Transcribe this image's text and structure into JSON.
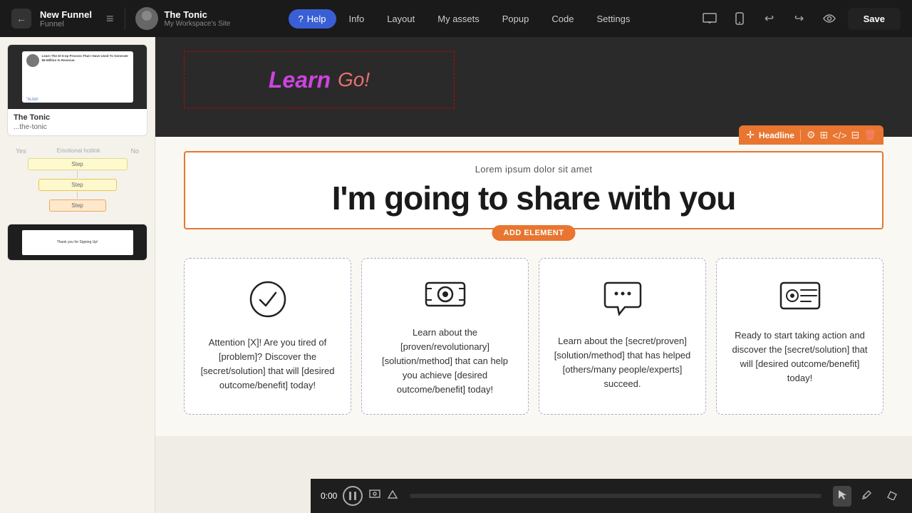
{
  "header": {
    "back_label": "←",
    "project_title": "New Funnel",
    "project_subtitle": "Funnel",
    "site_name": "The Tonic",
    "site_subtitle": "My Workspace's Site",
    "tabs": [
      {
        "id": "help",
        "label": "Help",
        "active": true
      },
      {
        "id": "info",
        "label": "Info",
        "active": false
      },
      {
        "id": "layout",
        "label": "Layout",
        "active": false
      },
      {
        "id": "my_assets",
        "label": "My assets",
        "active": false
      },
      {
        "id": "popup",
        "label": "Popup",
        "active": false
      },
      {
        "id": "code",
        "label": "Code",
        "active": false
      },
      {
        "id": "settings",
        "label": "Settings",
        "active": false
      }
    ],
    "device_icons": [
      "desktop",
      "mobile"
    ],
    "action_icons": [
      "undo",
      "redo",
      "preview"
    ],
    "save_label": "Save"
  },
  "headline_element": {
    "toolbar_label": "Headline",
    "label_above": "Lorem ipsum dolor sit amet",
    "main_text": "I'm going to share with you",
    "add_element_label": "ADD ELEMENT"
  },
  "feature_cards": [
    {
      "icon": "✓",
      "icon_type": "circle-check",
      "text": "Attention [X]! Are you tired of [problem]? Discover the [secret/solution] that will [desired outcome/benefit] today!"
    },
    {
      "icon": "💵",
      "icon_type": "money",
      "text": "Learn about the [proven/revolutionary] [solution/method] that can help you achieve [desired outcome/benefit] today!"
    },
    {
      "icon": "💬",
      "icon_type": "chat",
      "text": "Learn about the [secret/proven] [solution/method] that has helped [others/many people/experts] succeed."
    },
    {
      "icon": "🪪",
      "icon_type": "id-card",
      "text": "Ready to start taking action and discover the [secret/solution] that will [desired outcome/benefit] today!"
    }
  ],
  "sidebar": {
    "page_name": "The Tonic",
    "page_link": "...the-tonic",
    "funnel_steps": [
      {
        "label": "Step 1",
        "width": 140
      },
      {
        "label": "Step 2",
        "width": 110
      },
      {
        "label": "Step 3",
        "width": 80
      }
    ],
    "stats_left": "Yes",
    "stats_right": "No",
    "stats_middle": "Emotional hotlink"
  },
  "video_bar": {
    "time": "0:00",
    "tools": [
      "cursor",
      "pencil",
      "eraser"
    ]
  },
  "colors": {
    "accent_orange": "#e87530",
    "dark_bg": "#2a2a2a",
    "nav_bg": "#1a1a1a",
    "card_border": "#aaccaa"
  }
}
